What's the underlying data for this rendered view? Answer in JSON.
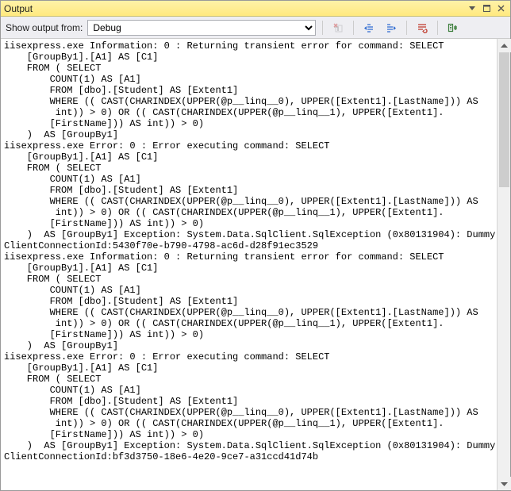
{
  "title": "Output",
  "toolbar": {
    "label": "Show output from:",
    "source_selected": "Debug",
    "buttons": [
      {
        "name": "clear-all",
        "enabled": false
      },
      {
        "name": "indent-left",
        "enabled": true
      },
      {
        "name": "indent-right",
        "enabled": true
      },
      {
        "name": "toggle-wrap",
        "enabled": true
      },
      {
        "name": "options",
        "enabled": true
      }
    ]
  },
  "output_lines": [
    "iisexpress.exe Information: 0 : Returning transient error for command: SELECT ",
    "    [GroupBy1].[A1] AS [C1]",
    "    FROM ( SELECT ",
    "        COUNT(1) AS [A1]",
    "        FROM [dbo].[Student] AS [Extent1]",
    "        WHERE (( CAST(CHARINDEX(UPPER(@p__linq__0), UPPER([Extent1].[LastName])) AS",
    "         int)) > 0) OR (( CAST(CHARINDEX(UPPER(@p__linq__1), UPPER([Extent1].",
    "        [FirstName])) AS int)) > 0)",
    "    )  AS [GroupBy1]",
    "iisexpress.exe Error: 0 : Error executing command: SELECT ",
    "    [GroupBy1].[A1] AS [C1]",
    "    FROM ( SELECT ",
    "        COUNT(1) AS [A1]",
    "        FROM [dbo].[Student] AS [Extent1]",
    "        WHERE (( CAST(CHARINDEX(UPPER(@p__linq__0), UPPER([Extent1].[LastName])) AS",
    "         int)) > 0) OR (( CAST(CHARINDEX(UPPER(@p__linq__1), UPPER([Extent1].",
    "        [FirstName])) AS int)) > 0)",
    "    )  AS [GroupBy1] Exception: System.Data.SqlClient.SqlException (0x80131904): Dummy",
    "ClientConnectionId:5430f70e-b790-4798-ac6d-d28f91ec3529",
    "iisexpress.exe Information: 0 : Returning transient error for command: SELECT ",
    "    [GroupBy1].[A1] AS [C1]",
    "    FROM ( SELECT ",
    "        COUNT(1) AS [A1]",
    "        FROM [dbo].[Student] AS [Extent1]",
    "        WHERE (( CAST(CHARINDEX(UPPER(@p__linq__0), UPPER([Extent1].[LastName])) AS",
    "         int)) > 0) OR (( CAST(CHARINDEX(UPPER(@p__linq__1), UPPER([Extent1].",
    "        [FirstName])) AS int)) > 0)",
    "    )  AS [GroupBy1]",
    "iisexpress.exe Error: 0 : Error executing command: SELECT ",
    "    [GroupBy1].[A1] AS [C1]",
    "    FROM ( SELECT ",
    "        COUNT(1) AS [A1]",
    "        FROM [dbo].[Student] AS [Extent1]",
    "        WHERE (( CAST(CHARINDEX(UPPER(@p__linq__0), UPPER([Extent1].[LastName])) AS",
    "         int)) > 0) OR (( CAST(CHARINDEX(UPPER(@p__linq__1), UPPER([Extent1].",
    "        [FirstName])) AS int)) > 0)",
    "    )  AS [GroupBy1] Exception: System.Data.SqlClient.SqlException (0x80131904): Dummy",
    "ClientConnectionId:bf3d3750-18e6-4e20-9ce7-a31ccd41d74b"
  ]
}
